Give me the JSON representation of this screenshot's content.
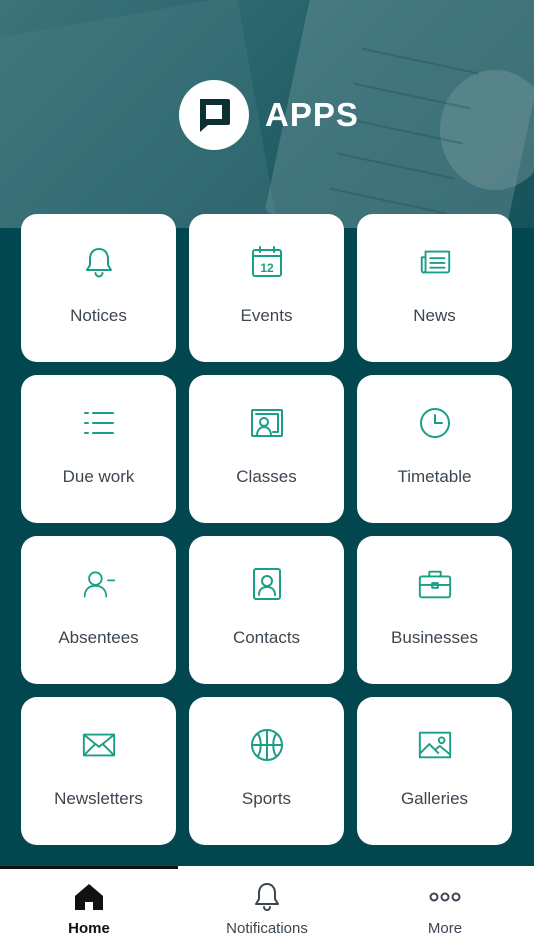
{
  "header": {
    "title": "APPS",
    "logo_icon": "chat-bubble-logo-icon"
  },
  "colors": {
    "accent": "#1a9e86",
    "background": "#02474f",
    "tile": "#ffffff",
    "label": "#3c4650"
  },
  "tiles": [
    {
      "label": "Notices",
      "icon": "bell-icon"
    },
    {
      "label": "Events",
      "icon": "calendar-icon"
    },
    {
      "label": "News",
      "icon": "newspaper-icon"
    },
    {
      "label": "Due work",
      "icon": "list-icon"
    },
    {
      "label": "Classes",
      "icon": "classroom-icon"
    },
    {
      "label": "Timetable",
      "icon": "clock-icon"
    },
    {
      "label": "Absentees",
      "icon": "user-minus-icon"
    },
    {
      "label": "Contacts",
      "icon": "contact-card-icon"
    },
    {
      "label": "Businesses",
      "icon": "briefcase-icon"
    },
    {
      "label": "Newsletters",
      "icon": "envelope-icon"
    },
    {
      "label": "Sports",
      "icon": "basketball-icon"
    },
    {
      "label": "Galleries",
      "icon": "image-icon"
    }
  ],
  "calendar_day": "12",
  "tabbar": {
    "items": [
      {
        "label": "Home",
        "icon": "home-icon",
        "active": true
      },
      {
        "label": "Notifications",
        "icon": "bell-icon",
        "active": false
      },
      {
        "label": "More",
        "icon": "more-dots-icon",
        "active": false
      }
    ]
  }
}
